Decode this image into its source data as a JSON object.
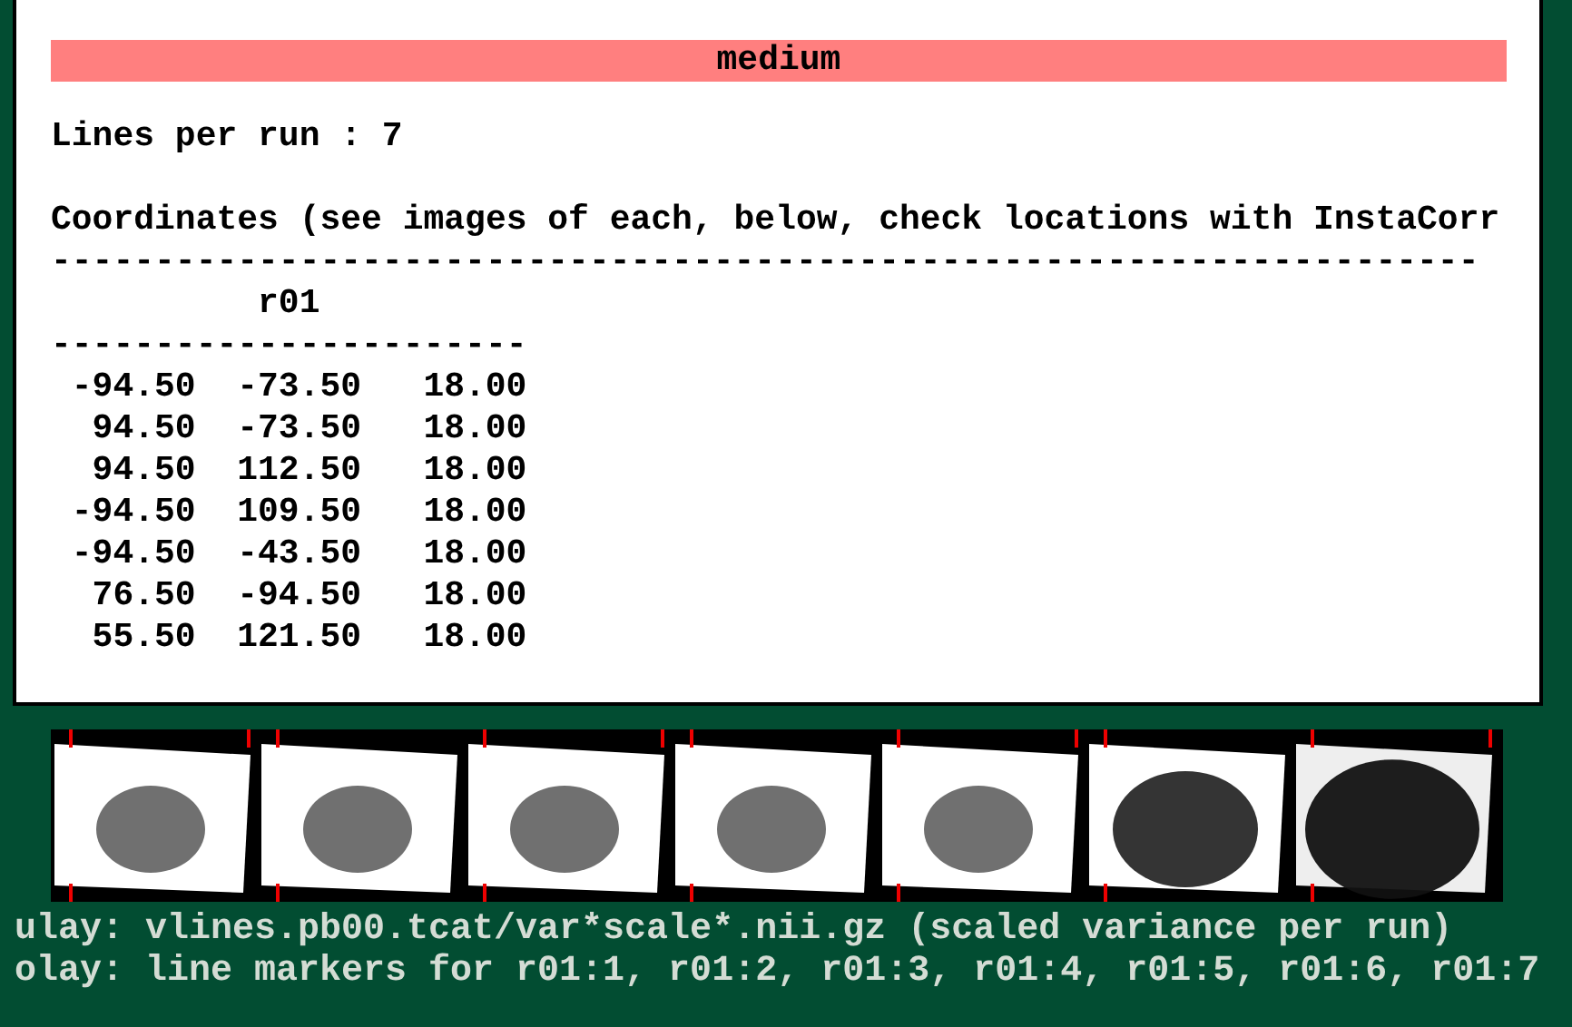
{
  "header": {
    "title": "medium"
  },
  "lines_per_run": "Lines per run : 7",
  "coordinates_heading": "Coordinates (see images of each, below, check locations with InstaCorr",
  "rule_long": "---------------------------------------------------------------------",
  "table": {
    "column_header": "r01",
    "rule": "-----------------------",
    "rows": [
      [
        "-94.50",
        "-73.50",
        "18.00"
      ],
      [
        "94.50",
        "-73.50",
        "18.00"
      ],
      [
        "94.50",
        "112.50",
        "18.00"
      ],
      [
        "-94.50",
        "109.50",
        "18.00"
      ],
      [
        "-94.50",
        "-43.50",
        "18.00"
      ],
      [
        "76.50",
        "-94.50",
        "18.00"
      ],
      [
        "55.50",
        "121.50",
        "18.00"
      ]
    ]
  },
  "thumbnails": [
    {
      "kind": "sparse"
    },
    {
      "kind": "sparse"
    },
    {
      "kind": "sparse"
    },
    {
      "kind": "sparse"
    },
    {
      "kind": "sparse"
    },
    {
      "kind": "dense"
    },
    {
      "kind": "dark"
    }
  ],
  "captions": [
    "ulay: vlines.pb00.tcat/var*scale*.nii.gz (scaled variance per run)",
    "olay: line markers for r01:1, r01:2, r01:3, r01:4, r01:5, r01:6, r01:7"
  ]
}
